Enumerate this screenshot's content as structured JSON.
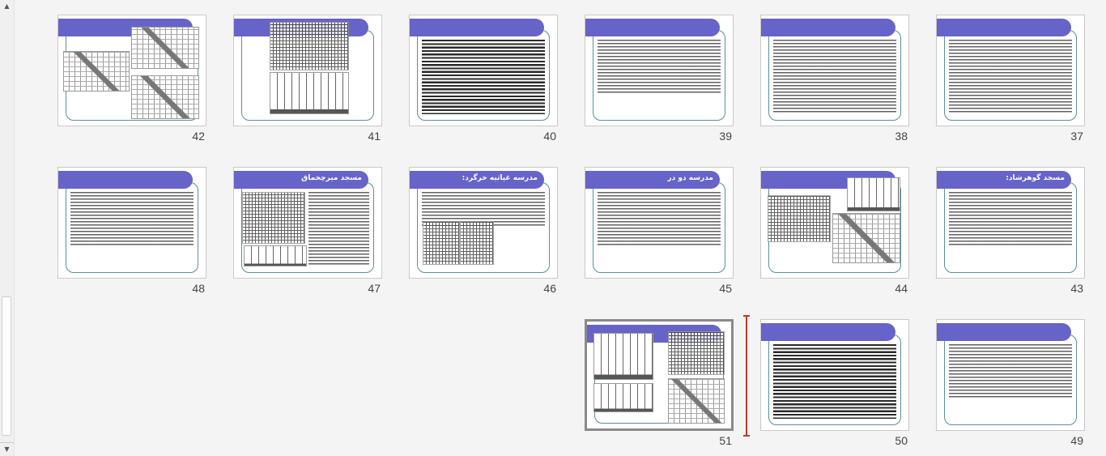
{
  "slides": {
    "s37": {
      "number": "37",
      "title": ""
    },
    "s38": {
      "number": "38",
      "title": ""
    },
    "s39": {
      "number": "39",
      "title": ""
    },
    "s40": {
      "number": "40",
      "title": ""
    },
    "s41": {
      "number": "41",
      "title": ""
    },
    "s42": {
      "number": "42",
      "title": ""
    },
    "s43": {
      "number": "43",
      "title": "مسجد گوهرشاد:"
    },
    "s44": {
      "number": "44",
      "title": ""
    },
    "s45": {
      "number": "45",
      "title": "مدرسه دو در"
    },
    "s46": {
      "number": "46",
      "title": "مدرسه غیاثیه خرگرد:"
    },
    "s47": {
      "number": "47",
      "title": "مسجد میرچخماق"
    },
    "s48": {
      "number": "48",
      "title": ""
    },
    "s49": {
      "number": "49",
      "title": ""
    },
    "s50": {
      "number": "50",
      "title": ""
    },
    "s51": {
      "number": "51",
      "title": ""
    }
  },
  "colors": {
    "title_band": "#6663c9",
    "frame_border": "#5a8f9b",
    "insertion_marker": "#c0392b"
  },
  "icons": {
    "scroll_up": "triangle-up",
    "scroll_down": "triangle-down"
  }
}
